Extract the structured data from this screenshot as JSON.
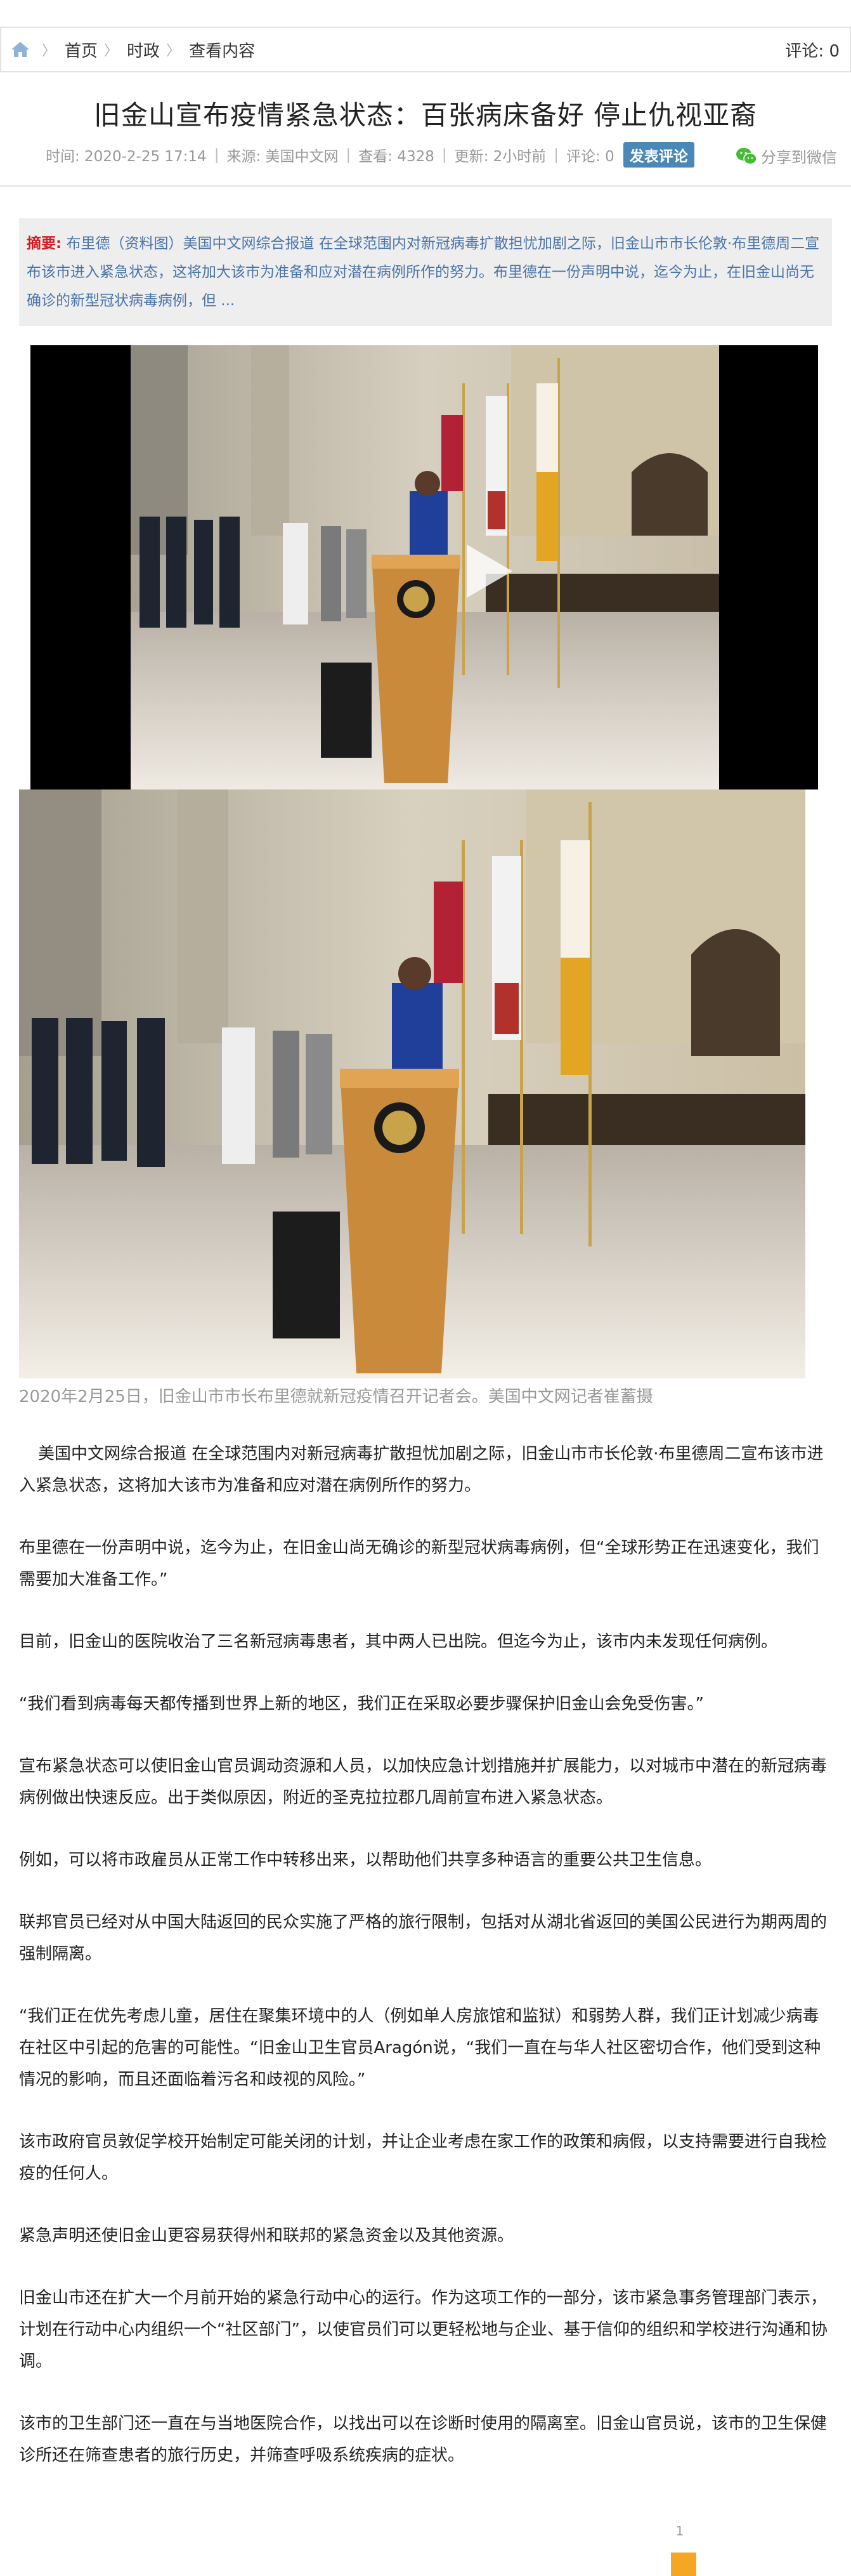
{
  "breadcrumb": {
    "home": "首页",
    "category": "时政",
    "current": "查看内容",
    "comment_label": "评论: 0"
  },
  "article": {
    "title": "旧金山宣布疫情紧急状态：百张病床备好 停止仇视亚裔",
    "meta": {
      "time": "时间: 2020-2-25 17:14",
      "source": "来源: 美国中文网",
      "views": "查看: 4328",
      "updated": "更新: 2小时前",
      "comments": "评论: 0",
      "post_comment": "发表评论"
    },
    "share_wechat": "分享到微信",
    "abstract_label": "摘要:",
    "abstract_text": "布里德（资料图）美国中文网综合报道 在全球范围内对新冠病毒扩散担忧加剧之际，旧金山市市长伦敦·布里德周二宣布该市进入紧急状态，这将加大该市为准备和应对潜在病例所作的努力。布里德在一份声明中说，迄今为止，在旧金山尚无确诊的新型冠状病毒病例，但 ...",
    "caption": "2020年2月25日，旧金山市市长布里德就新冠疫情召开记者会。美国中文网记者崔蓄摄",
    "paragraphs": [
      "美国中文网综合报道 在全球范围内对新冠病毒扩散担忧加剧之际，旧金山市市长伦敦·布里德周二宣布该市进入紧急状态，这将加大该市为准备和应对潜在病例所作的努力。",
      "布里德在一份声明中说，迄今为止，在旧金山尚无确诊的新型冠状病毒病例，但“全球形势正在迅速变化，我们需要加大准备工作。”",
      "目前，旧金山的医院收治了三名新冠病毒患者，其中两人已出院。但迄今为止，该市内未发现任何病例。",
      "“我们看到病毒每天都传播到世界上新的地区，我们正在采取必要步骤保护旧金山会免受伤害。”",
      "宣布紧急状态可以使旧金山官员调动资源和人员，以加快应急计划措施并扩展能力，以对城市中潜在的新冠病毒病例做出快速反应。出于类似原因，附近的圣克拉拉郡几周前宣布进入紧急状态。",
      "例如，可以将市政雇员从正常工作中转移出来，以帮助他们共享多种语言的重要公共卫生信息。",
      "联邦官员已经对从中国大陆返回的民众实施了严格的旅行限制，包括对从湖北省返回的美国公民进行为期两周的强制隔离。",
      "“我们正在优先考虑儿童，居住在聚集环境中的人（例如单人房旅馆和监狱）和弱势人群，我们正计划减少病毒在社区中引起的危害的可能性。“旧金山卫生官员Aragón说，“我们一直在与华人社区密切合作，他们受到这种情况的影响，而且还面临着污名和歧视的风险。”",
      "该市政府官员敦促学校开始制定可能关闭的计划，并让企业考虑在家工作的政策和病假，以支持需要进行自我检疫的任何人。",
      "紧急声明还使旧金山更容易获得州和联邦的紧急资金以及其他资源。",
      "旧金山市还在扩大一个月前开始的紧急行动中心的运行。作为这项工作的一部分，该市紧急事务管理部门表示，计划在行动中心内组织一个“社区部门”，以使官员们可以更轻松地与企业、基于信仰的组织和学校进行沟通和协调。",
      "该市的卫生部门还一直在与当地医院合作，以找出可以在诊断时使用的隔离室。旧金山官员说，该市的卫生保健诊所还在筛查患者的旅行历史，并筛查呼吸系统疾病的症状。"
    ]
  },
  "pager": {
    "page": "1"
  },
  "colors": {
    "accent_blue": "#4a88b8",
    "abstract_text": "#4a74a8",
    "abstract_label": "#cc1f1f",
    "pager_dot": "#f5a623"
  }
}
